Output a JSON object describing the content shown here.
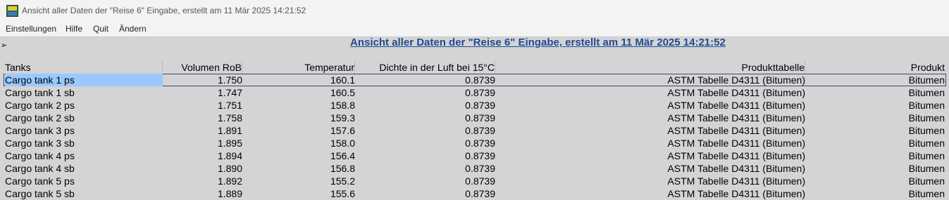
{
  "window": {
    "title": "Ansicht aller Daten der \"Reise 6\" Eingabe, erstellt am 11 Mär 2025  14:21:52",
    "icon": "app-logo-icon"
  },
  "menu": {
    "items": [
      "Einstellungen",
      "Hilfe",
      "Quit",
      "Ändern"
    ]
  },
  "heading": "Ansicht aller Daten der \"Reise 6\" Eingabe, erstellt am 11 Mär 2025  14:21:52 ",
  "table": {
    "columns": [
      "Tanks",
      "Volumen RoB",
      "Temperatur",
      "Dichte in der Luft bei 15°C",
      "Produkttabelle",
      "Produkt"
    ],
    "rows": [
      [
        "Cargo tank 1 ps",
        "1.750",
        "160.1",
        "0.8739",
        "ASTM Tabelle D4311 (Bitumen)",
        "Bitumen"
      ],
      [
        "Cargo tank 1 sb",
        "1.747",
        "160.5",
        "0.8739",
        "ASTM Tabelle D4311 (Bitumen)",
        "Bitumen"
      ],
      [
        "Cargo tank 2 ps",
        "1.751",
        "158.8",
        "0.8739",
        "ASTM Tabelle D4311 (Bitumen)",
        "Bitumen"
      ],
      [
        "Cargo tank 2 sb",
        "1.758",
        "159.3",
        "0.8739",
        "ASTM Tabelle D4311 (Bitumen)",
        "Bitumen"
      ],
      [
        "Cargo tank 3 ps",
        "1.891",
        "157.6",
        "0.8739",
        "ASTM Tabelle D4311 (Bitumen)",
        "Bitumen"
      ],
      [
        "Cargo tank 3 sb",
        "1.895",
        "158.0",
        "0.8739",
        "ASTM Tabelle D4311 (Bitumen)",
        "Bitumen"
      ],
      [
        "Cargo tank 4 ps",
        "1.894",
        "156.4",
        "0.8739",
        "ASTM Tabelle D4311 (Bitumen)",
        "Bitumen"
      ],
      [
        "Cargo tank 4 sb",
        "1.890",
        "156.8",
        "0.8739",
        "ASTM Tabelle D4311 (Bitumen)",
        "Bitumen"
      ],
      [
        "Cargo tank 5 ps",
        "1.892",
        "155.2",
        "0.8739",
        "ASTM Tabelle D4311 (Bitumen)",
        "Bitumen"
      ],
      [
        "Cargo tank 5 sb",
        "1.889",
        "155.6",
        "0.8739",
        "ASTM Tabelle D4311 (Bitumen)",
        "Bitumen"
      ]
    ],
    "selected_row": 0
  },
  "colors": {
    "background": "#d4d4d4",
    "heading": "#1e4a93",
    "selection": "#99c9ff"
  }
}
